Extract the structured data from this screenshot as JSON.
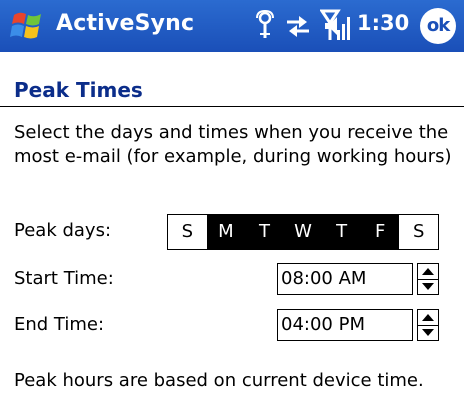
{
  "titlebar": {
    "app_title": "ActiveSync",
    "time": "1:30",
    "ok_label": "ok",
    "icons": [
      "windows-flag-icon",
      "connectivity-icon",
      "sync-icon",
      "signal-icon",
      "volume-icon"
    ]
  },
  "section": {
    "title": "Peak Times"
  },
  "description": "Select the days and times when you receive the most e-mail (for example, during working hours)",
  "peak_days": {
    "label": "Peak days:",
    "days": [
      {
        "letter": "S",
        "selected": false
      },
      {
        "letter": "M",
        "selected": true
      },
      {
        "letter": "T",
        "selected": true
      },
      {
        "letter": "W",
        "selected": true
      },
      {
        "letter": "T",
        "selected": true
      },
      {
        "letter": "F",
        "selected": true
      },
      {
        "letter": "S",
        "selected": false
      }
    ]
  },
  "start_time": {
    "label": "Start Time:",
    "value": "08:00 AM"
  },
  "end_time": {
    "label": "End Time:",
    "value": "04:00 PM"
  },
  "footer_note": "Peak hours are based on current device time.",
  "colors": {
    "titlebar": "#1a4fb8",
    "section_title": "#0b2d8a"
  }
}
